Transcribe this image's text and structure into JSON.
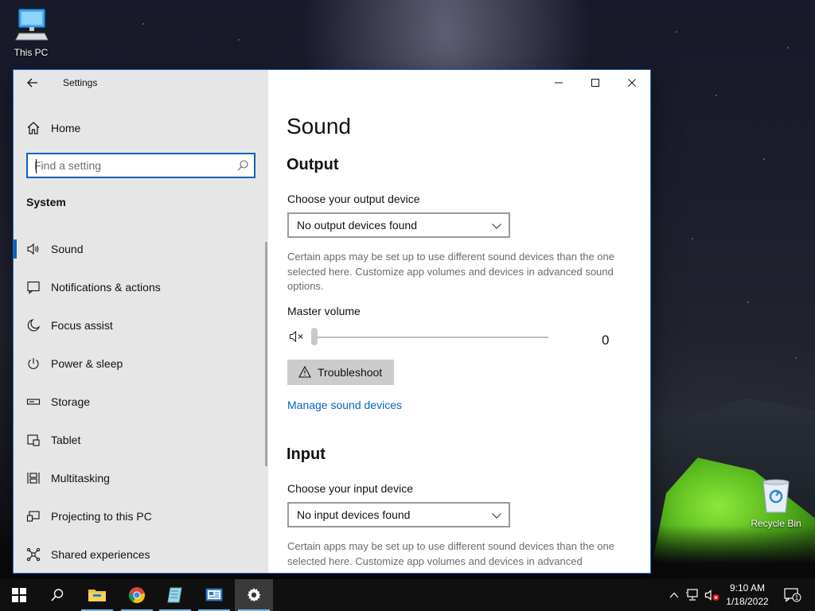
{
  "desktop": {
    "icons": [
      {
        "label": "This PC"
      },
      {
        "label": "Recycle Bin"
      }
    ]
  },
  "window": {
    "title": "Settings",
    "sidebar": {
      "home_label": "Home",
      "search_placeholder": "Find a setting",
      "section": "System",
      "items": [
        {
          "label": "Sound",
          "icon": "speaker-icon",
          "selected": true
        },
        {
          "label": "Notifications & actions",
          "icon": "notification-icon"
        },
        {
          "label": "Focus assist",
          "icon": "moon-icon"
        },
        {
          "label": "Power & sleep",
          "icon": "power-icon"
        },
        {
          "label": "Storage",
          "icon": "storage-icon"
        },
        {
          "label": "Tablet",
          "icon": "tablet-icon"
        },
        {
          "label": "Multitasking",
          "icon": "multitasking-icon"
        },
        {
          "label": "Projecting to this PC",
          "icon": "projecting-icon"
        },
        {
          "label": "Shared experiences",
          "icon": "shared-experiences-icon"
        }
      ]
    },
    "content": {
      "page_title": "Sound",
      "output": {
        "heading": "Output",
        "device_label": "Choose your output device",
        "device_value": "No output devices found",
        "help_text": "Certain apps may be set up to use different sound devices than the one selected here. Customize app volumes and devices in advanced sound options.",
        "volume_label": "Master volume",
        "volume_value": "0",
        "volume_level": 0,
        "troubleshoot_label": "Troubleshoot",
        "manage_link": "Manage sound devices"
      },
      "input": {
        "heading": "Input",
        "device_label": "Choose your input device",
        "device_value": "No input devices found",
        "help_text": "Certain apps may be set up to use different sound devices than the one selected here. Customize app volumes and devices in advanced"
      }
    }
  },
  "taskbar": {
    "apps": [
      "start-icon",
      "search-icon",
      "file-explorer-icon",
      "chrome-icon",
      "app-icon",
      "control-panel-icon",
      "settings-icon"
    ],
    "active_app": "settings-icon",
    "clock_time": "9:10 AM",
    "clock_date": "1/18/2022",
    "notification_count": "1"
  },
  "colors": {
    "accent": "#0a62c2",
    "sidebar_bg": "#e6e6e6",
    "taskbar_bg": "#101010"
  }
}
